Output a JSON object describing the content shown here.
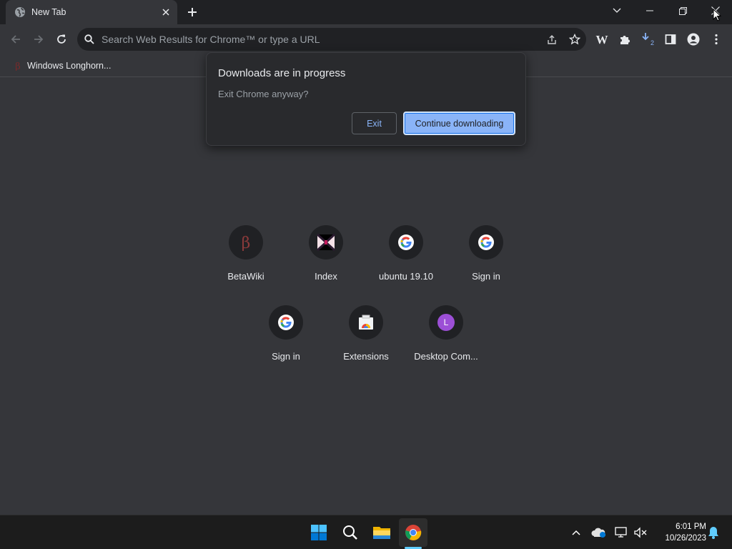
{
  "tab": {
    "title": "New Tab"
  },
  "omnibox": {
    "placeholder": "Search Web Results for Chrome™ or type a URL"
  },
  "bookmarks": [
    {
      "label": "Windows Longhorn..."
    }
  ],
  "dialog": {
    "title": "Downloads are in progress",
    "message": "Exit Chrome anyway?",
    "exit_label": "Exit",
    "continue_label": "Continue downloading"
  },
  "toolbar": {
    "download_count": "2"
  },
  "shortcuts": [
    {
      "label": "BetaWiki",
      "icon": "betawiki-icon"
    },
    {
      "label": "Index",
      "icon": "index-icon"
    },
    {
      "label": "ubuntu 19.10",
      "icon": "google-icon"
    },
    {
      "label": "Sign in",
      "icon": "google-icon"
    },
    {
      "label": "Sign in",
      "icon": "google-icon"
    },
    {
      "label": "Extensions",
      "icon": "chrome-web-store-icon"
    },
    {
      "label": "Desktop Com...",
      "icon": "letter-avatar-icon",
      "letter": "L"
    }
  ],
  "taskbar": {
    "time": "6:01 PM",
    "date": "10/26/2023"
  },
  "colors": {
    "accent": "#8ab4f8",
    "background": "#35363a",
    "tabstrip": "#202124"
  }
}
